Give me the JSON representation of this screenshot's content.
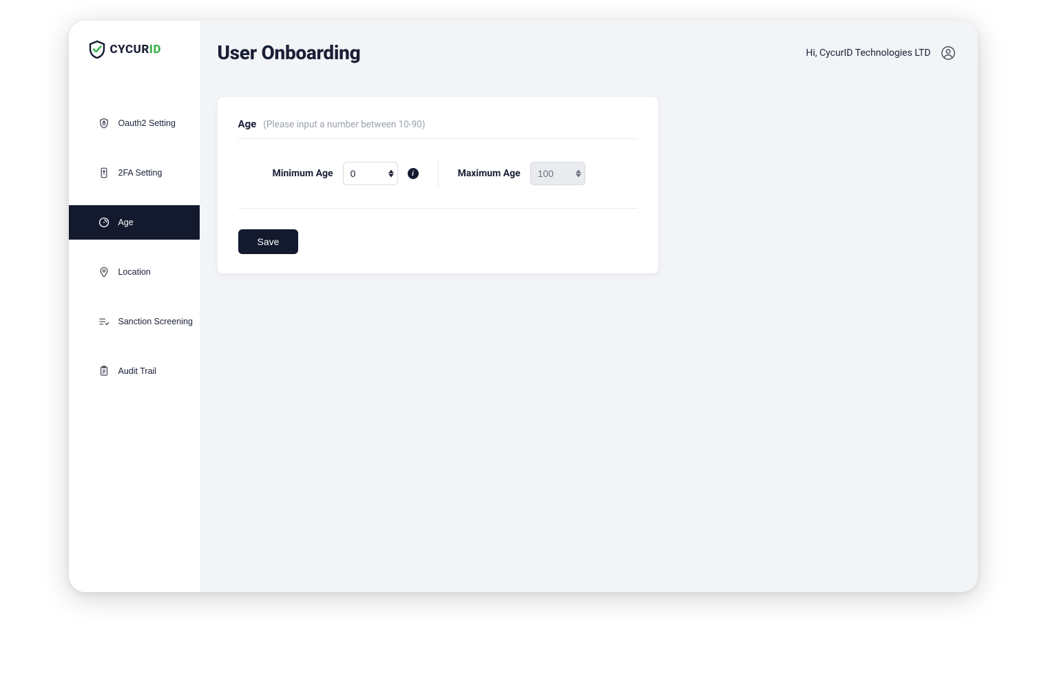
{
  "brand": {
    "name_left": "CYCUR",
    "name_right": "ID"
  },
  "header": {
    "title": "User Onboarding",
    "greeting": "Hi, CycurID Technologies LTD"
  },
  "sidebar": {
    "items": [
      {
        "label": "Oauth2 Setting",
        "icon": "shield-lock-icon",
        "active": false
      },
      {
        "label": "2FA Setting",
        "icon": "phone-key-icon",
        "active": false
      },
      {
        "label": "Age",
        "icon": "gauge-icon",
        "active": true
      },
      {
        "label": "Location",
        "icon": "location-pin-icon",
        "active": false
      },
      {
        "label": "Sanction Screening",
        "icon": "list-check-icon",
        "active": false
      },
      {
        "label": "Audit Trail",
        "icon": "clipboard-icon",
        "active": false
      }
    ]
  },
  "card": {
    "section_title": "Age",
    "hint": "(Please input a number between 10-90)",
    "min_label": "Minimum Age",
    "min_value": "0",
    "max_label": "Maximum Age",
    "max_value": "100",
    "save_label": "Save"
  }
}
